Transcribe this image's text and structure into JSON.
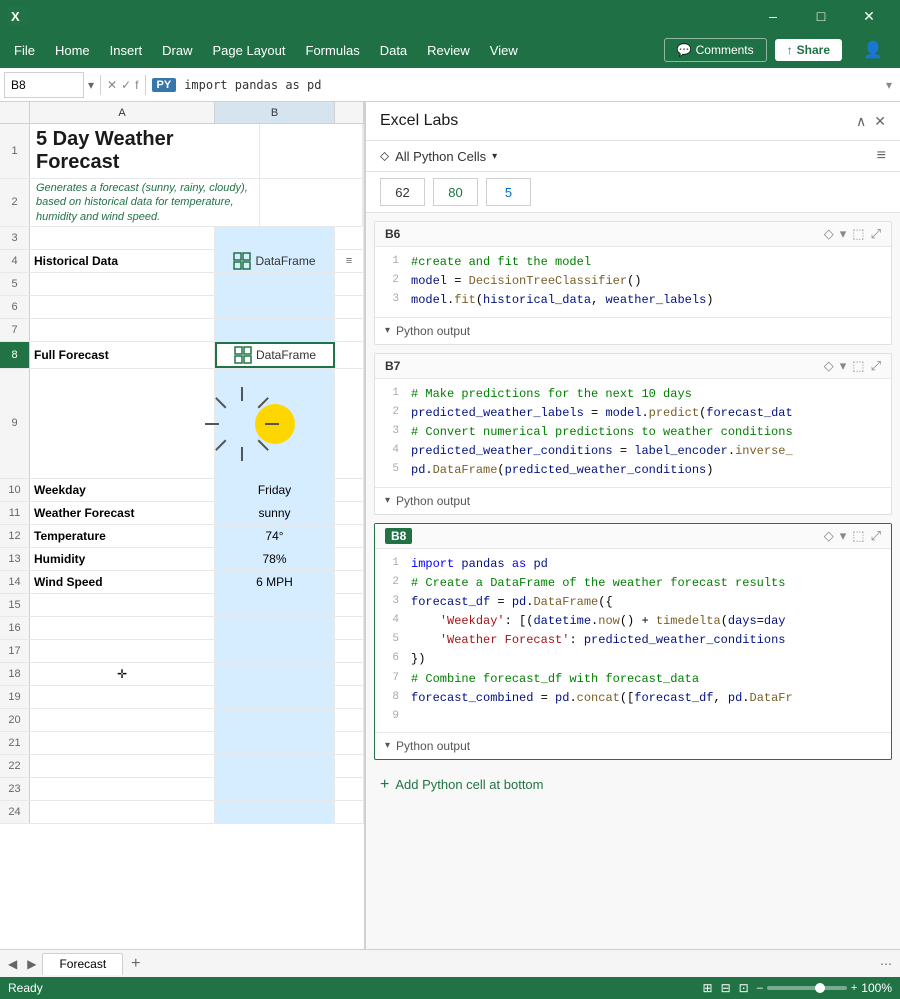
{
  "titlebar": {
    "app_name": "Microsoft Excel",
    "minimize": "–",
    "maximize": "□",
    "close": "✕"
  },
  "menubar": {
    "items": [
      "File",
      "Home",
      "Insert",
      "Draw",
      "Page Layout",
      "Formulas",
      "Data",
      "Review",
      "View"
    ],
    "comments_label": "Comments",
    "share_label": "Share"
  },
  "formulabar": {
    "cell_ref": "B8",
    "py_badge": "PY",
    "formula": "import pandas as pd"
  },
  "spreadsheet": {
    "title": "5 Day Weather Forecast",
    "subtitle": "Generates a forecast (sunny, rainy, cloudy), based on historical data for temperature, humidity and wind speed.",
    "col_a": "A",
    "col_b": "B",
    "rows": [
      {
        "num": "1",
        "a": "",
        "b": ""
      },
      {
        "num": "2",
        "a": "",
        "b": ""
      },
      {
        "num": "3",
        "a": "",
        "b": ""
      },
      {
        "num": "4",
        "a": "Historical Data",
        "b": "DataFrame"
      },
      {
        "num": "8",
        "a": "Full Forecast",
        "b": "DataFrame"
      },
      {
        "num": "10",
        "a": "Weekday",
        "b": "Friday"
      },
      {
        "num": "11",
        "a": "Weather Forecast",
        "b": "sunny"
      },
      {
        "num": "12",
        "a": "Temperature",
        "b": "74°"
      },
      {
        "num": "13",
        "a": "Humidity",
        "b": "78%"
      },
      {
        "num": "14",
        "a": "Wind Speed",
        "b": "6 MPH"
      }
    ]
  },
  "excel_labs": {
    "title": "Excel Labs",
    "filter_label": "All Python Cells",
    "inputs": [
      "62",
      "80",
      "5"
    ],
    "cells": [
      {
        "id": "B6",
        "active": false,
        "lines": [
          {
            "num": "1",
            "code": "#create and fit the model",
            "type": "comment"
          },
          {
            "num": "2",
            "code": "model = DecisionTreeClassifier()",
            "type": "mixed"
          },
          {
            "num": "3",
            "code": "model.fit(historical_data, weather_labels)",
            "type": "mixed"
          }
        ],
        "has_output": true,
        "output_label": "Python output"
      },
      {
        "id": "B7",
        "active": false,
        "lines": [
          {
            "num": "1",
            "code": "# Make predictions for the next 10 days",
            "type": "comment"
          },
          {
            "num": "2",
            "code": "predicted_weather_labels = model.predict(forecast_dat",
            "type": "mixed"
          },
          {
            "num": "3",
            "code": "# Convert numerical predictions to weather conditions",
            "type": "comment"
          },
          {
            "num": "4",
            "code": "predicted_weather_conditions = label_encoder.inverse_",
            "type": "mixed"
          },
          {
            "num": "5",
            "code": "pd.DataFrame(predicted_weather_conditions)",
            "type": "mixed"
          }
        ],
        "has_output": true,
        "output_label": "Python output"
      },
      {
        "id": "B8",
        "active": true,
        "lines": [
          {
            "num": "1",
            "code": "import pandas as pd",
            "type": "import"
          },
          {
            "num": "2",
            "code": "# Create a DataFrame of the weather forecast results",
            "type": "comment"
          },
          {
            "num": "3",
            "code": "forecast_df = pd.DataFrame({",
            "type": "mixed"
          },
          {
            "num": "4",
            "code": "    'Weekday': [(datetime.now() + timedelta(days=day",
            "type": "string"
          },
          {
            "num": "5",
            "code": "    'Weather Forecast': predicted_weather_conditions",
            "type": "string"
          },
          {
            "num": "6",
            "code": "})",
            "type": "mixed"
          },
          {
            "num": "7",
            "code": "# Combine forecast_df with forecast_data",
            "type": "comment"
          },
          {
            "num": "8",
            "code": "forecast_combined = pd.concat([forecast_df, pd.DataFr",
            "type": "mixed"
          },
          {
            "num": "9",
            "code": "",
            "type": "empty"
          }
        ],
        "has_output": true,
        "output_label": "Python output"
      }
    ],
    "add_cell_label": "Add Python cell at bottom"
  },
  "tabs": {
    "sheet_name": "Forecast",
    "add_label": "+"
  },
  "statusbar": {
    "status": "Ready",
    "zoom": "100%"
  }
}
